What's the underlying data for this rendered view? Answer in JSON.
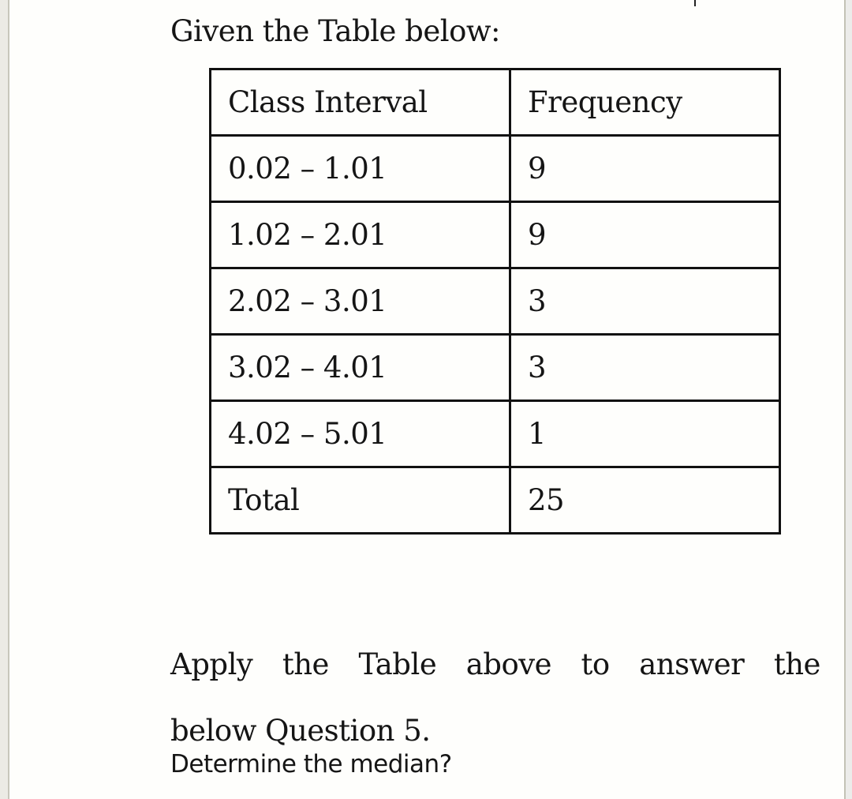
{
  "intro": "Given the Table below:",
  "table": {
    "headers": [
      "Class Interval",
      "Frequency"
    ],
    "rows": [
      {
        "interval": "0.02 – 1.01",
        "frequency": "9"
      },
      {
        "interval": "1.02 – 2.01",
        "frequency": "9"
      },
      {
        "interval": "2.02 – 3.01",
        "frequency": "3"
      },
      {
        "interval": "3.02 – 4.01",
        "frequency": "3"
      },
      {
        "interval": "4.02 – 5.01",
        "frequency": "1"
      },
      {
        "interval": "Total",
        "frequency": "25"
      }
    ]
  },
  "instruction": {
    "line1_words": [
      "Apply",
      "the",
      "Table",
      "above",
      "to",
      "answer",
      "the"
    ],
    "line2": "below Question 5."
  },
  "question": "Determine the median?"
}
